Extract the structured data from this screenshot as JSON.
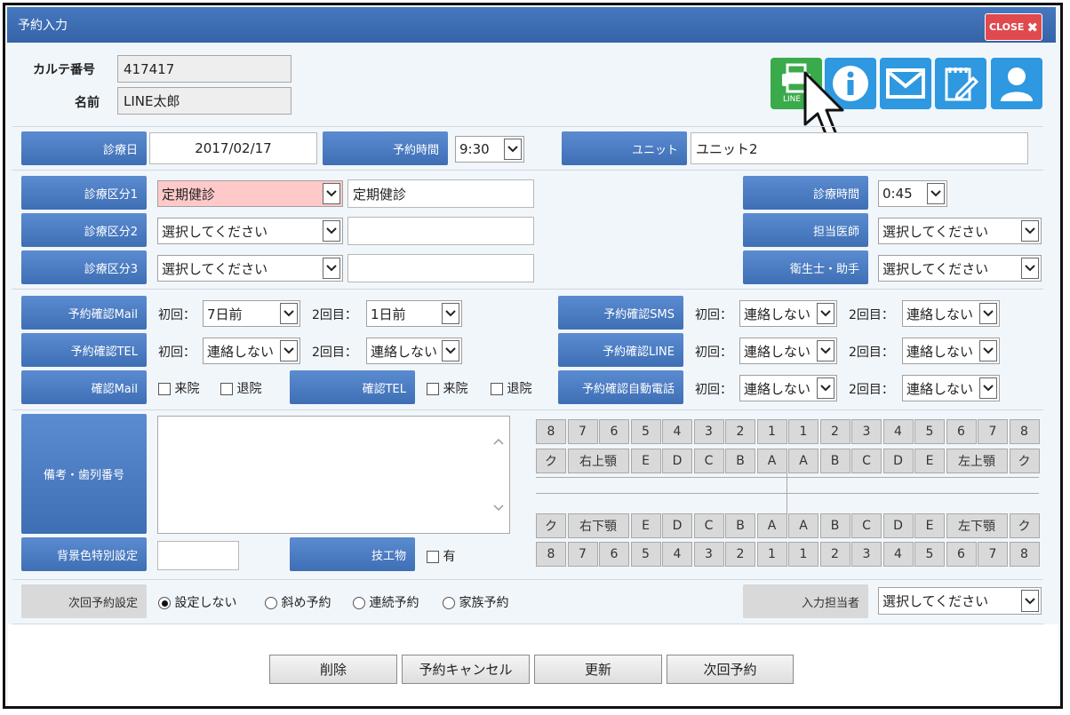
{
  "window": {
    "title": "予約入力",
    "close_label": "CLOSE"
  },
  "patient": {
    "chart_label": "カルテ番号",
    "chart_value": "417417",
    "name_label": "名前",
    "name_value": "LINE太郎"
  },
  "toolbar": {
    "line_print_text": "LINE"
  },
  "visit": {
    "date_label": "診療日",
    "date_value": "2017/02/17",
    "time_label": "予約時間",
    "time_value": "9:30",
    "unit_label": "ユニット",
    "unit_value": "ユニット2"
  },
  "categories": {
    "cat1_label": "診療区分1",
    "cat1_value": "定期健診",
    "cat1_text": "定期健診",
    "cat2_label": "診療区分2",
    "cat2_value": "選択してください",
    "cat2_text": "",
    "cat3_label": "診療区分3",
    "cat3_value": "選択してください",
    "cat3_text": "",
    "duration_label": "診療時間",
    "duration_value": "0:45",
    "doctor_label": "担当医師",
    "doctor_value": "選択してください",
    "hygienist_label": "衛生士・助手",
    "hygienist_value": "選択してください"
  },
  "confirm": {
    "first_label": "初回：",
    "second_label": "2回目：",
    "mail_label": "予約確認Mail",
    "mail_first": "7日前",
    "mail_second": "1日前",
    "tel_label": "予約確認TEL",
    "tel_first": "連絡しない",
    "tel_second": "連絡しない",
    "sms_label": "予約確認SMS",
    "sms_first": "連絡しない",
    "sms_second": "連絡しない",
    "line_label": "予約確認LINE",
    "line_first": "連絡しない",
    "line_second": "連絡しない",
    "auto_label": "予約確認自動電話",
    "auto_first": "連絡しない",
    "auto_second": "連絡しない",
    "check_mail_label": "確認Mail",
    "check_tel_label": "確認TEL",
    "visit_label": "来院",
    "leave_label": "退院"
  },
  "notes": {
    "label": "備考・歯列番号",
    "value": "",
    "bg_label": "背景色特別設定",
    "bg_value": "",
    "lab_label": "技工物",
    "lab_check": "有"
  },
  "teeth": {
    "upper_numbers": [
      "8",
      "7",
      "6",
      "5",
      "4",
      "3",
      "2",
      "1",
      "1",
      "2",
      "3",
      "4",
      "5",
      "6",
      "7",
      "8"
    ],
    "upper_labels": [
      "ク",
      "右上顎",
      "E",
      "D",
      "C",
      "B",
      "A",
      "A",
      "B",
      "C",
      "D",
      "E",
      "左上顎",
      "ク"
    ],
    "lower_labels": [
      "ク",
      "右下顎",
      "E",
      "D",
      "C",
      "B",
      "A",
      "A",
      "B",
      "C",
      "D",
      "E",
      "左下顎",
      "ク"
    ],
    "lower_numbers": [
      "8",
      "7",
      "6",
      "5",
      "4",
      "3",
      "2",
      "1",
      "1",
      "2",
      "3",
      "4",
      "5",
      "6",
      "7",
      "8"
    ]
  },
  "next": {
    "label": "次回予約設定",
    "options": [
      "設定しない",
      "斜め予約",
      "連続予約",
      "家族予約"
    ],
    "selected_index": 0,
    "staff_label": "入力担当者",
    "staff_value": "選択してください"
  },
  "buttons": {
    "delete": "削除",
    "cancel": "予約キャンセル",
    "update": "更新",
    "next": "次回予約"
  }
}
